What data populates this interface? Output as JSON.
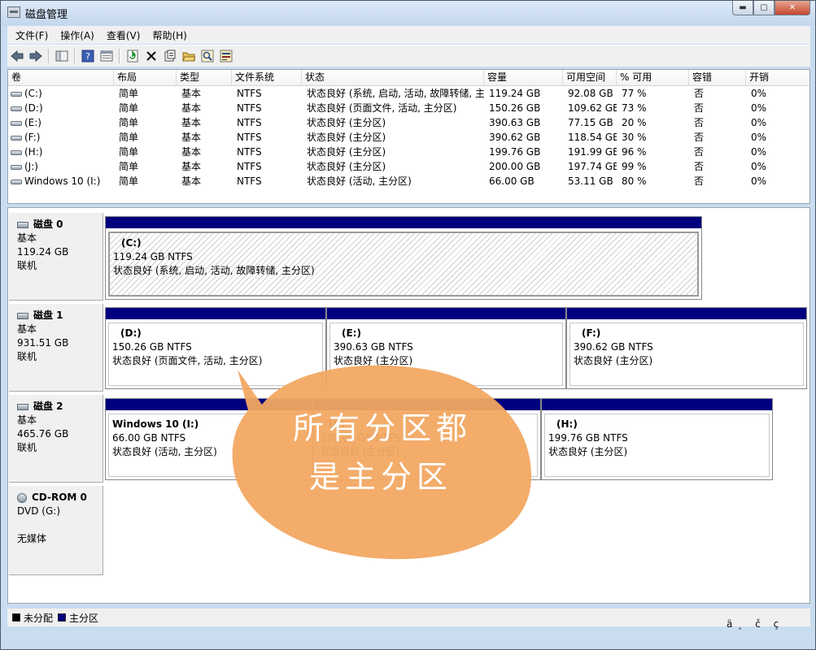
{
  "window": {
    "title": "磁盘管理",
    "minimize": "▬",
    "maximize": "▢",
    "close": "✕"
  },
  "menu": [
    "文件(F)",
    "操作(A)",
    "查看(V)",
    "帮助(H)"
  ],
  "toolbar_icons": [
    "back-icon",
    "forward-icon",
    "console-tree-icon",
    "help-icon",
    "properties-pane-icon",
    "refresh-icon",
    "delete-icon",
    "properties-icon",
    "open-folder-icon",
    "search-icon",
    "rescan-icon"
  ],
  "volumes": {
    "headers": [
      "卷",
      "布局",
      "类型",
      "文件系统",
      "状态",
      "容量",
      "可用空间",
      "% 可用",
      "容错",
      "开销"
    ],
    "rows": [
      [
        "(C:)",
        "简单",
        "基本",
        "NTFS",
        "状态良好 (系统, 启动, 活动, 故障转储, 主分区)",
        "119.24 GB",
        "92.08 GB",
        "77 %",
        "否",
        "0%"
      ],
      [
        "(D:)",
        "简单",
        "基本",
        "NTFS",
        "状态良好 (页面文件, 活动, 主分区)",
        "150.26 GB",
        "109.62 GB",
        "73 %",
        "否",
        "0%"
      ],
      [
        "(E:)",
        "简单",
        "基本",
        "NTFS",
        "状态良好 (主分区)",
        "390.63 GB",
        "77.15 GB",
        "20 %",
        "否",
        "0%"
      ],
      [
        "(F:)",
        "简单",
        "基本",
        "NTFS",
        "状态良好 (主分区)",
        "390.62 GB",
        "118.54 GB",
        "30 %",
        "否",
        "0%"
      ],
      [
        "(H:)",
        "简单",
        "基本",
        "NTFS",
        "状态良好 (主分区)",
        "199.76 GB",
        "191.99 GB",
        "96 %",
        "否",
        "0%"
      ],
      [
        "(J:)",
        "简单",
        "基本",
        "NTFS",
        "状态良好 (主分区)",
        "200.00 GB",
        "197.74 GB",
        "99 %",
        "否",
        "0%"
      ],
      [
        "Windows 10 (I:)",
        "简单",
        "基本",
        "NTFS",
        "状态良好 (活动, 主分区)",
        "66.00 GB",
        "53.11 GB",
        "80 %",
        "否",
        "0%"
      ]
    ]
  },
  "disks": [
    {
      "name": "磁盘 0",
      "type": "基本",
      "size": "119.24 GB",
      "status": "联机",
      "partitions": [
        {
          "name": "(C:)",
          "size": "119.24 GB NTFS",
          "status": "状态良好 (系统, 启动, 活动, 故障转储, 主分区)"
        }
      ]
    },
    {
      "name": "磁盘 1",
      "type": "基本",
      "size": "931.51 GB",
      "status": "联机",
      "partitions": [
        {
          "name": "(D:)",
          "size": "150.26 GB NTFS",
          "status": "状态良好 (页面文件, 活动, 主分区)"
        },
        {
          "name": "(E:)",
          "size": "390.63 GB NTFS",
          "status": "状态良好 (主分区)"
        },
        {
          "name": "(F:)",
          "size": "390.62 GB NTFS",
          "status": "状态良好 (主分区)"
        }
      ]
    },
    {
      "name": "磁盘 2",
      "type": "基本",
      "size": "465.76 GB",
      "status": "联机",
      "partitions": [
        {
          "name": "Windows 10  (I:)",
          "size": "66.00 GB NTFS",
          "status": "状态良好 (活动, 主分区)"
        },
        {
          "name": "(J:)",
          "size": "200.00 GB NTFS",
          "status": "状态良好 (主分区)"
        },
        {
          "name": "(H:)",
          "size": "199.76 GB NTFS",
          "status": "状态良好 (主分区)"
        }
      ]
    },
    {
      "name": "CD-ROM 0",
      "type": "DVD (G:)",
      "status": "无媒体"
    }
  ],
  "legend": [
    {
      "label": "未分配",
      "color": "#000000"
    },
    {
      "label": "主分区",
      "color": "#00007f"
    }
  ],
  "annotation": {
    "line1": "所有分区都",
    "line2": "是主分区",
    "color": "#f2a862"
  },
  "watermark": "ä¸ č ç"
}
